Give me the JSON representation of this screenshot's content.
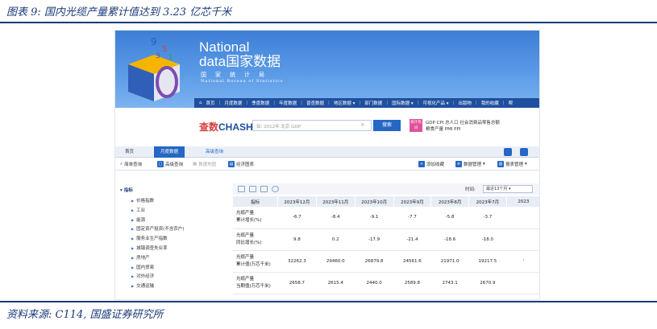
{
  "figure": {
    "title": "图表 9:  国内光缆产量累计值达到 3.23 亿芯千米",
    "source": "资料来源: C114, 国盛证券研究所"
  },
  "site": {
    "name_line1": "National",
    "name_line2": "data国家数据",
    "bureau_cn": "国家统计局",
    "bureau_en": "National Bureau of Statistics",
    "accent": "#2467c4",
    "banner_color": "#4a8ddf"
  },
  "nav": {
    "items": [
      "首页",
      "月度数据",
      "季度数据",
      "年度数据",
      "普查数据",
      "地区数据 ▾",
      "部门数据",
      "国际数据 ▾",
      "可视化产品 ▾",
      "出版物",
      "我的收藏",
      "帮"
    ]
  },
  "search": {
    "brand_a": "查数",
    "brand_b": "CHASHU",
    "placeholder": "如: 2012年 北京 GDP",
    "button": "搜索",
    "badge": "统计热词",
    "hot_line1": "GDP  CPI  总人口  社会消费品零售总额",
    "hot_line2": "粮食产量  PMI  PPI"
  },
  "tabs": {
    "home": "首页",
    "monthly": "月度数据",
    "advanced": "高级查询"
  },
  "toolbar": {
    "simple_query": "简单查询",
    "advanced_query": "高级查询",
    "data_map": "数据地图",
    "econ_chart": "经济图表",
    "add_fav": "添加收藏",
    "data_mgmt": "数据管理",
    "report_mgmt": "报表管理"
  },
  "tree": {
    "root": "指标",
    "items": [
      "价格指数",
      "工业",
      "能源",
      "固定资产投资(不含农户)",
      "服务业生产指数",
      "城镇调查失业率",
      "房地产",
      "国内贸易",
      "对外经济",
      "交通运输"
    ]
  },
  "table": {
    "time_label": "时间:",
    "time_value": "最近13个月",
    "header_indicator": "指标",
    "columns": [
      "2023年12月",
      "2023年11月",
      "2023年10月",
      "2023年9月",
      "2023年8月",
      "2023年7月",
      "2023"
    ],
    "rows": [
      {
        "name1": "光缆产量",
        "name2": "累计增长(%)",
        "values": [
          "-6.7",
          "-8.4",
          "-9.1",
          "-7.7",
          "-5.8",
          "-3.7",
          ""
        ]
      },
      {
        "name1": "光缆产量",
        "name2": "同比增长(%)",
        "values": [
          "9.8",
          "0.2",
          "-17.9",
          "-21.4",
          "-18.6",
          "-18.0",
          ""
        ]
      },
      {
        "name1": "光缆产量",
        "name2": "累计值(万芯千米)",
        "values": [
          "32262.3",
          "29460.0",
          "26879.8",
          "24561.6",
          "21971.0",
          "19217.5",
          "'"
        ]
      },
      {
        "name1": "光缆产量",
        "name2": "当期值(万芯千米)",
        "values": [
          "2658.7",
          "2615.4",
          "2440.0",
          "2589.8",
          "2743.1",
          "2670.9",
          ""
        ]
      }
    ]
  }
}
